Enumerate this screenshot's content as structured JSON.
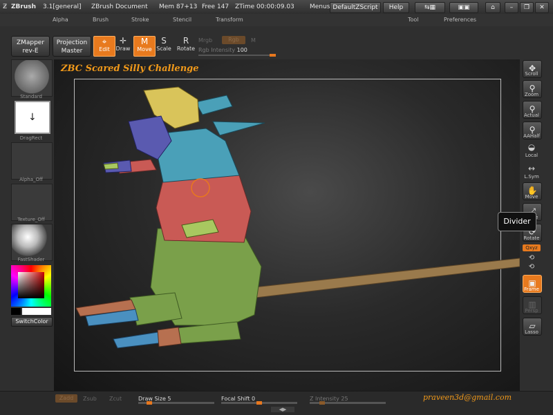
{
  "titlebar": {
    "app_name": "ZBrush",
    "version": "3.1[general]",
    "document": "ZBrush Document",
    "mem": "Mem 87+13",
    "free": "Free 147",
    "ztime": "ZTime 00:00:09.03",
    "menus_label": "Menus",
    "script_button": "DefaultZScript",
    "help_button": "Help"
  },
  "menubar": {
    "items": [
      "Alpha",
      "Brush",
      "Stroke",
      "Stencil",
      "Transform",
      "Tool",
      "Preferences"
    ]
  },
  "toolbar": {
    "zmapper_line1": "ZMapper",
    "zmapper_line2": "rev-E",
    "projection_line1": "Projection",
    "projection_line2": "Master",
    "edit": "Edit",
    "draw": "Draw",
    "move": "Move",
    "scale": "Scale",
    "rotate": "Rotate",
    "mrgb": "Mrgb",
    "rgb": "Rgb",
    "m": "M",
    "rgb_intensity_label": "Rgb Intensity",
    "rgb_intensity_value": "100"
  },
  "leftpanel": {
    "standard": "Standard",
    "dragrect": "DragRect",
    "alpha": "Alpha_Off",
    "texture": "Texture_Off",
    "fastshader": "FastShader",
    "switchcolor": "SwitchColor"
  },
  "canvas": {
    "title": "ZBC Scared Silly Challenge",
    "tooltip": "Divider",
    "email": "praveen3d@gmail.com"
  },
  "rightpanel": {
    "scroll": "Scroll",
    "zoom": "Zoom",
    "actual": "Actual",
    "aahalf": "AAHalf",
    "local": "Local",
    "lsym": "L.Sym",
    "move": "Move",
    "scale": "Scale",
    "rotate": "Rotate",
    "xyz": "Qxyz",
    "frame": "Frame",
    "persp": "Persp",
    "lasso": "Lasso"
  },
  "bottombar": {
    "zadd": "Zadd",
    "zsub": "Zsub",
    "zcut": "Zcut",
    "draw_size_label": "Draw Size",
    "draw_size_value": "5",
    "focal_shift_label": "Focal Shift",
    "focal_shift_value": "0",
    "z_intensity_label": "Z Intensity",
    "z_intensity_value": "25"
  },
  "colors": {
    "accent": "#e87a1e",
    "title_text": "#f29a1a"
  }
}
